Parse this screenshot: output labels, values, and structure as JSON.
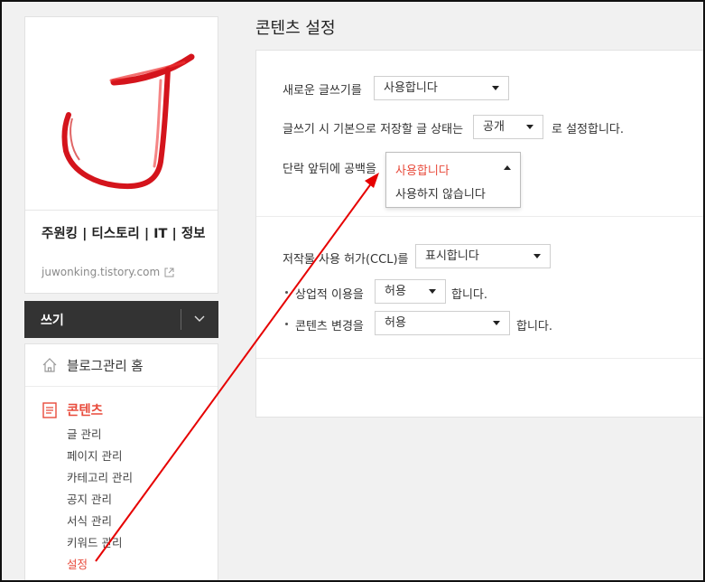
{
  "sidebar": {
    "blog_title": "주원킹 | 티스토리 | IT | 정보",
    "blog_url": "juwonking.tistory.com",
    "write_label": "쓰기",
    "home_label": "블로그관리 홈",
    "content_label": "콘텐츠",
    "items": [
      {
        "label": "글 관리"
      },
      {
        "label": "페이지 관리"
      },
      {
        "label": "카테고리 관리"
      },
      {
        "label": "공지 관리"
      },
      {
        "label": "서식 관리"
      },
      {
        "label": "키워드 관리"
      },
      {
        "label": "설정"
      }
    ]
  },
  "main": {
    "title": "콘텐츠 설정",
    "new_editor": {
      "label": "새로운 글쓰기를",
      "value": "사용합니다"
    },
    "default_status": {
      "label": "글쓰기 시 기본으로 저장할 글 상태는",
      "value": "공개",
      "suffix": "로 설정합니다."
    },
    "paragraph_spacing": {
      "label": "단락 앞뒤에 공백을",
      "options": [
        "사용합니다",
        "사용하지 않습니다"
      ]
    },
    "ccl": {
      "label": "저작물 사용 허가(CCL)를",
      "value": "표시합니다"
    },
    "commercial": {
      "label": "상업적 이용을",
      "value": "허용",
      "suffix": "합니다."
    },
    "modification": {
      "label": "콘텐츠 변경을",
      "value": "허용",
      "suffix": "합니다."
    }
  },
  "colors": {
    "accent": "#e84b3c",
    "dark": "#333333",
    "arrow": "#e60000"
  }
}
